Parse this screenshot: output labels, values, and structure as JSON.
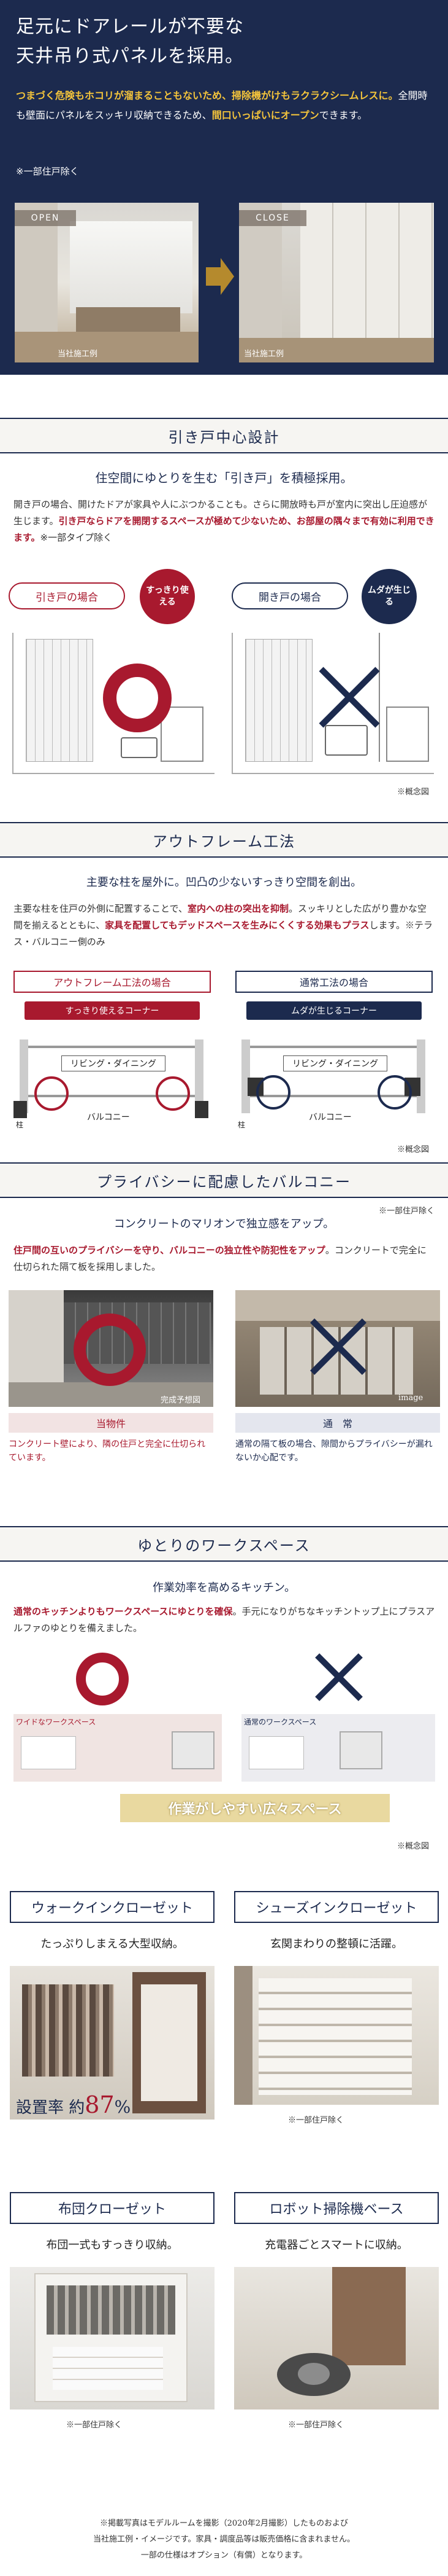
{
  "hero": {
    "title_line1": "足元にドアレールが不要な",
    "title_line2": "天井吊り式パネルを採用。",
    "highlight": "つまづく危険もホコリが溜まることもないため、掃除機がけもラクラクシームレスに。",
    "body_plain": "全開時も壁面にパネルをスッキリ収納できるため、",
    "highlight2": "間口いっぱいにオープン",
    "body_tail": "できます。",
    "note": "※一部住戸除く",
    "open_label": "OPEN",
    "close_label": "CLOSE",
    "open_caption": "当社施工例",
    "close_caption": "当社施工例"
  },
  "sliding": {
    "section_title": "引き戸中心設計",
    "lead": "住空間にゆとりを生む「引き戸」を積極採用。",
    "body": "開き戸の場合、開けたドアが家具や人にぶつかることも。さらに開放時も戸が室内に突出し圧迫感が生じます。",
    "body_bold": "引き戸ならドアを開閉するスペースが極めて少ないため、お部屋の隅々まで有効に利用できます。",
    "body_note": "※一部タイプ除く",
    "left_pill": "引き戸の場合",
    "left_bubble": "すっきり使える",
    "right_pill": "開き戸の場合",
    "right_bubble": "ムダが生じる",
    "caption": "※概念図"
  },
  "outframe": {
    "section_title": "アウトフレーム工法",
    "lead": "主要な柱を屋外に。凹凸の少ないすっきり空間を創出。",
    "body": "主要な柱を住戸の外側に配置することで、",
    "body_bold1": "室内への柱の突出を抑制",
    "body_mid": "。スッキリとした広がり豊かな空間を揃えるとともに、",
    "body_bold2": "家具を配置してもデッドスペースを生みにくくする効果もプラス",
    "body_tail": "します。※テラス・バルコニー側のみ",
    "left_label": "アウトフレーム工法の場合",
    "left_corner": "すっきり使えるコーナー",
    "right_label": "通常工法の場合",
    "right_corner": "ムダが生じるコーナー",
    "living": "リビング・ダイニング",
    "balcony": "バルコニー",
    "pillar": "柱",
    "caption": "※概念図"
  },
  "balcony": {
    "section_title": "プライバシーに配慮したバルコニー",
    "note_top": "※一部住戸除く",
    "lead": "コンクリートのマリオンで独立感をアップ。",
    "body_bold": "住戸間の互いのプライバシーを守り、バルコニーの独立性や防犯性をアップ",
    "body_tail": "。コンクリートで完全に仕切られた隔て板を採用しました。",
    "left_caption": "完成予想図",
    "right_caption": "image",
    "left_label": "当物件",
    "left_text": "コンクリート壁により、隣の住戸と完全に仕切られています。",
    "right_label": "通　常",
    "right_text": "通常の隔て板の場合、隙間からプライバシーが漏れないか心配です。"
  },
  "workspace": {
    "section_title": "ゆとりのワークスペース",
    "lead": "作業効率を高めるキッチン。",
    "body_bold": "通常のキッチンよりもワークスペースにゆとりを確保",
    "body_tail": "。手元になりがちなキッチントップ上にプラスアルファのゆとりを備えました。",
    "left_label": "ワイドなワークスペース",
    "right_label": "通常のワークスペース",
    "ribbon": "作業がしやすい広々スペース",
    "caption": "※概念図"
  },
  "closets": [
    {
      "title": "ウォークインクローゼット",
      "desc": "たっぷりしまえる大型収納。",
      "rate_label": "設置率 約",
      "rate_value": "87",
      "rate_unit": "%"
    },
    {
      "title": "シューズインクローゼット",
      "desc": "玄関まわりの整頓に活躍。",
      "note": "※一部住戸除く"
    },
    {
      "title": "布団クローゼット",
      "desc": "布団一式もすっきり収納。",
      "note": "※一部住戸除く"
    },
    {
      "title": "ロボット掃除機ベース",
      "desc": "充電器ごとスマートに収納。",
      "note": "※一部住戸除く"
    }
  ],
  "footer": {
    "line1": "※掲載写真はモデルルームを撮影（2020年2月撮影）したものおよび",
    "line2": "当社施工例・イメージです。家具・調度品等は販売価格に含まれません。",
    "line3": "一部の仕様はオプション（有償）となります。"
  },
  "colors": {
    "navy": "#1c2a4e",
    "accent": "#a8192e",
    "gold": "#f5c53b"
  }
}
